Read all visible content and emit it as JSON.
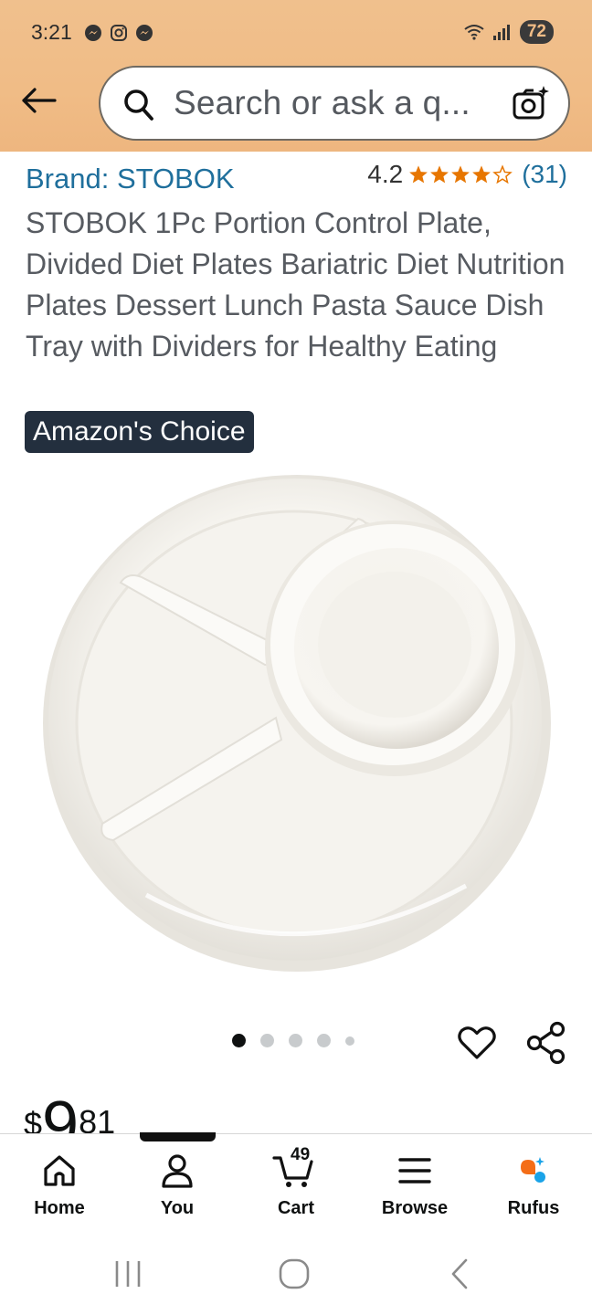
{
  "status_bar": {
    "time": "3:21",
    "battery": "72",
    "notification_icons": [
      "messenger-icon",
      "instagram-icon",
      "messenger-icon"
    ],
    "system_icons": [
      "wifi-icon",
      "signal-icon",
      "battery-icon"
    ]
  },
  "header": {
    "back_icon": "back-arrow-icon",
    "search_placeholder": "Search or ask a q...",
    "camera_icon": "camera-search-icon"
  },
  "product": {
    "brand": "Brand: STOBOK",
    "rating_value": "4.2",
    "rating_count": "(31)",
    "stars": 4.2,
    "title": "STOBOK 1Pc Portion Control Plate, Divided Diet Plates Bariatric Diet Nutrition Plates Dessert Lunch Pasta Sauce Dish Tray with Dividers for Healthy Eating",
    "badge": "Amazon's Choice",
    "image_dots": 5,
    "active_dot": 0,
    "price_currency": "$",
    "price_dollars": "9",
    "price_cents": "81"
  },
  "bottom_nav": {
    "items": [
      {
        "label": "Home",
        "icon": "home-icon"
      },
      {
        "label": "You",
        "icon": "user-icon"
      },
      {
        "label": "Cart",
        "icon": "cart-icon",
        "count": "49"
      },
      {
        "label": "Browse",
        "icon": "menu-icon"
      },
      {
        "label": "Rufus",
        "icon": "rufus-icon"
      }
    ]
  },
  "colors": {
    "header_bg": "#f0bc86",
    "link_blue": "#1f6f9c",
    "star_orange": "#e77600",
    "badge_bg": "#232f3e"
  }
}
